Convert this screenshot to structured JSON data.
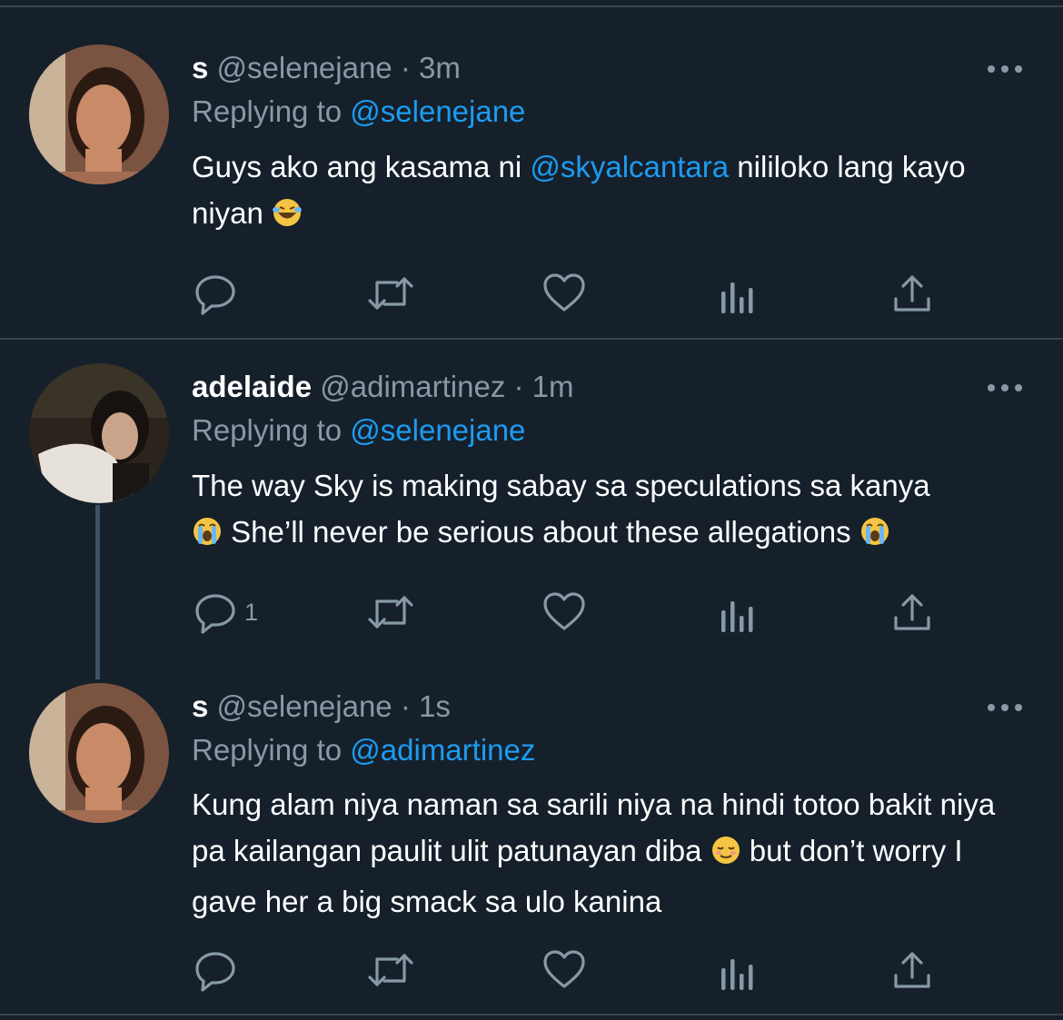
{
  "tweets": [
    {
      "name": "s",
      "handle": "@selenejane",
      "time": "· 3m",
      "replying_prefix": "Replying to",
      "replying_to": "@selenejane",
      "text_a": "Guys ako ang kasama ni ",
      "mention": "@skyalcantara",
      "text_b": " nililoko lang kayo niyan",
      "emoji": "laughing-tears",
      "reply_count": ""
    },
    {
      "name": "adelaide",
      "handle": "@adimartinez",
      "time": "· 1m",
      "replying_prefix": "Replying to",
      "replying_to": "@selenejane",
      "text_a": "The way Sky is making sabay sa speculations sa kanya",
      "text_b": "She’ll never be serious about these allegations",
      "emoji": "loudly-crying",
      "reply_count": "1"
    },
    {
      "name": "s",
      "handle": "@selenejane",
      "time": "· 1s",
      "replying_prefix": "Replying to",
      "replying_to": "@adimartinez",
      "text_a": "Kung alam niya naman sa sarili niya na hindi totoo bakit niya pa kailangan paulit ulit patunayan diba",
      "text_b": " but don’t worry I gave her a big smack sa ulo kanina",
      "emoji": "relieved-face",
      "reply_count": ""
    }
  ],
  "icons": [
    "reply-icon",
    "retweet-icon",
    "like-icon",
    "analytics-icon",
    "share-icon",
    "more-icon"
  ],
  "colors": {
    "background": "#15202b",
    "text": "#ffffff",
    "muted": "#8899a6",
    "link": "#1d9bf0",
    "icon": "#8899a6",
    "divider": "#38444d"
  }
}
